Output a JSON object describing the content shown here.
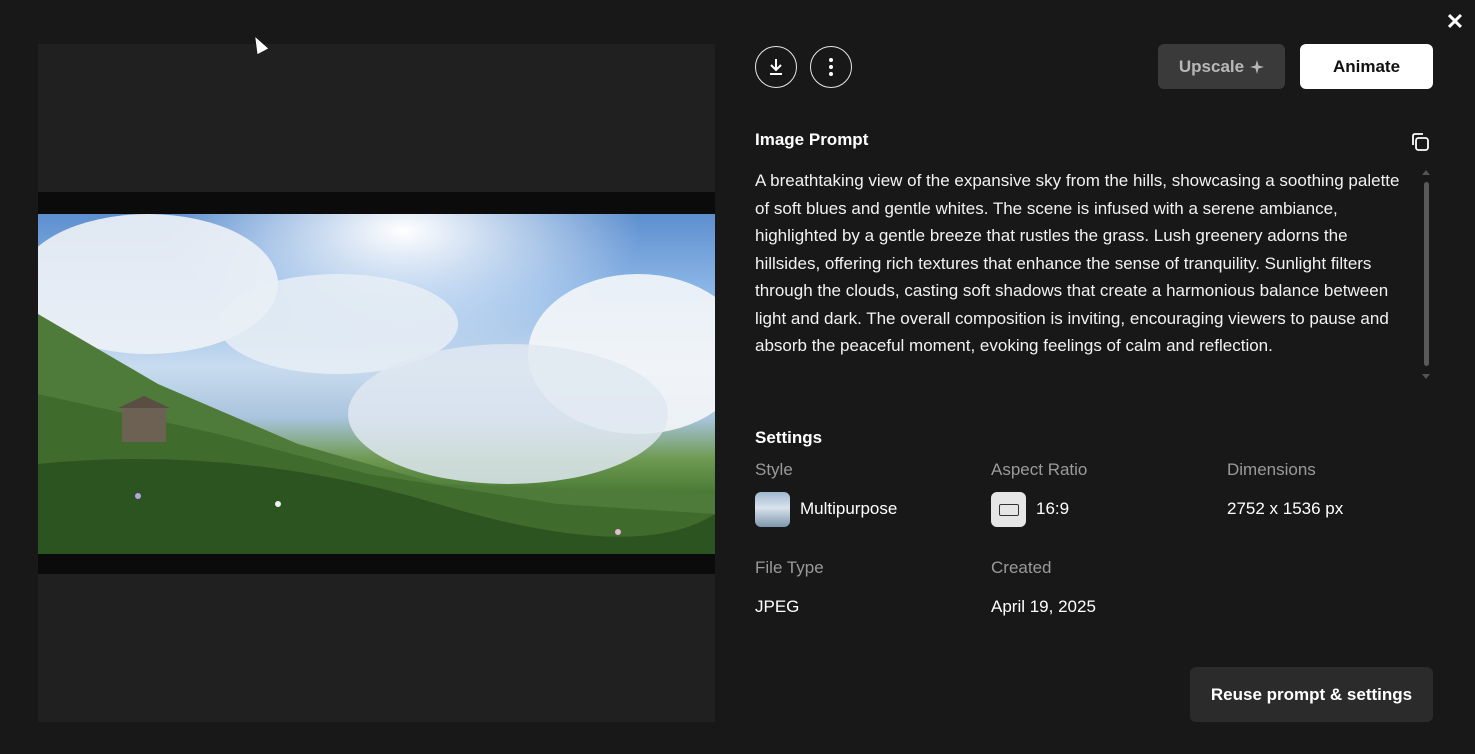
{
  "close_icon": "close-icon",
  "actions": {
    "download_icon": "download-icon",
    "more_icon": "more-vertical-icon",
    "upscale_label": "Upscale",
    "upscale_icon": "sparkle-icon",
    "animate_label": "Animate"
  },
  "prompt": {
    "title": "Image Prompt",
    "copy_icon": "copy-icon",
    "text": "A breathtaking view of the expansive sky from the hills, showcasing a soothing palette of soft blues and gentle whites. The scene is infused with a serene ambiance, highlighted by a gentle breeze that rustles the grass. Lush greenery adorns the hillsides, offering rich textures that enhance the sense of tranquility. Sunlight filters through the clouds, casting soft shadows that create a harmonious balance between light and dark. The overall composition is inviting, encouraging viewers to pause and absorb the peaceful moment, evoking feelings of calm and reflection."
  },
  "settings": {
    "title": "Settings",
    "style_label": "Style",
    "style_value": "Multipurpose",
    "aspect_label": "Aspect Ratio",
    "aspect_value": "16:9",
    "dimensions_label": "Dimensions",
    "dimensions_value": "2752 x 1536 px",
    "filetype_label": "File Type",
    "filetype_value": "JPEG",
    "created_label": "Created",
    "created_value": "April 19, 2025"
  },
  "reuse_label": "Reuse prompt & settings"
}
